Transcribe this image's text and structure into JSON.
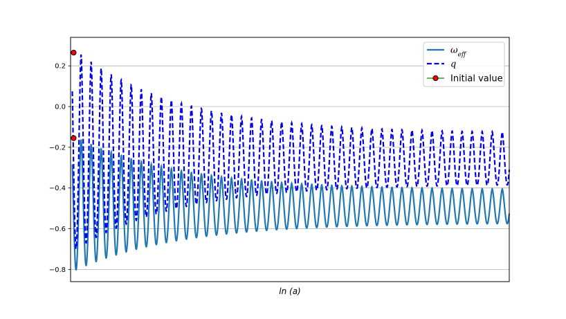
{
  "chart_data": {
    "type": "line",
    "title": "",
    "xlabel_parts": {
      "prefix": "ln (",
      "var": "a",
      "suffix": ")"
    },
    "ylabel": "",
    "xlim": [
      0,
      50
    ],
    "ylim": [
      -0.86,
      0.34
    ],
    "yticks": [
      0.2,
      0.0,
      -0.2,
      -0.4,
      -0.6,
      -0.8
    ],
    "ytick_labels": [
      "0.2",
      "0.0",
      "−0.2",
      "−0.4",
      "−0.6",
      "−0.8"
    ],
    "grid": {
      "horizontal": true,
      "vertical": false
    },
    "legend_position": "top-right",
    "series": [
      {
        "name_parts": {
          "base": "ω",
          "sub": "eff"
        },
        "style": "solid",
        "color": "#1f77b4",
        "x_start": 0.2,
        "x_end": 50,
        "num_peaks": 43,
        "first_peak_x": 1.2,
        "last_peak_x": 49.2,
        "peak_values_start": -0.14,
        "peak_values_end": -0.405,
        "trough_values_start": -0.81,
        "trough_values_end": -0.575,
        "end_value": -0.51
      },
      {
        "name_parts": {
          "base": "q"
        },
        "style": "dashed",
        "color": "#0000ee",
        "x_start": 0.2,
        "x_end": 50,
        "num_peaks": 43,
        "first_peak_x": 1.2,
        "last_peak_x": 49.2,
        "peak_values_start": 0.29,
        "peak_values_end": -0.125,
        "trough_values_start": -0.71,
        "trough_values_end": -0.385,
        "end_value": -0.26
      }
    ],
    "initial_value": {
      "name": "Initial value",
      "color": "#ff0000",
      "edge_color": "#000000",
      "line_color": "#2ca02c",
      "points": [
        {
          "x": 0.35,
          "y": 0.265
        },
        {
          "x": 0.35,
          "y": -0.155
        }
      ]
    }
  }
}
